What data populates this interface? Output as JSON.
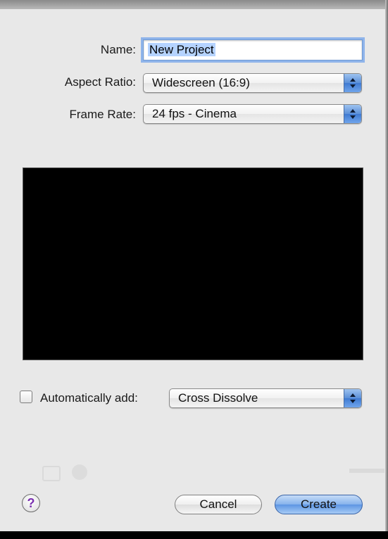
{
  "form": {
    "name_label": "Name:",
    "name_value": "New Project",
    "aspect_label": "Aspect Ratio:",
    "aspect_value": "Widescreen (16:9)",
    "framerate_label": "Frame Rate:",
    "framerate_value": "24 fps - Cinema"
  },
  "transition": {
    "checkbox_label": "Automatically add:",
    "checked": false,
    "value": "Cross Dissolve"
  },
  "buttons": {
    "help": "?",
    "cancel": "Cancel",
    "create": "Create"
  },
  "colors": {
    "dialog_bg": "#e8e8e8",
    "accent_blue": "#5b8fd8",
    "help_glyph": "#7a2fb0"
  },
  "icons": {
    "popup_arrows": "up-down-arrows-icon",
    "help": "question-mark-icon"
  }
}
